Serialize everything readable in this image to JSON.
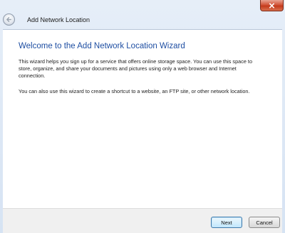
{
  "window": {
    "title": "Add Network Location",
    "back_icon": "back-arrow-icon",
    "close_icon": "close-icon",
    "close_color": "#c43a1c"
  },
  "wizard": {
    "heading": "Welcome to the Add Network Location Wizard",
    "heading_color": "#1e4ea2",
    "paragraph1": "This wizard helps you sign up for a service that offers online storage space.  You can use this space to store, organize, and share your documents and pictures using only a web browser and Internet connection.",
    "paragraph2": "You can also use this wizard to create a shortcut to a website, an FTP site, or other network location."
  },
  "footer": {
    "next_label": "Next",
    "cancel_label": "Cancel"
  }
}
